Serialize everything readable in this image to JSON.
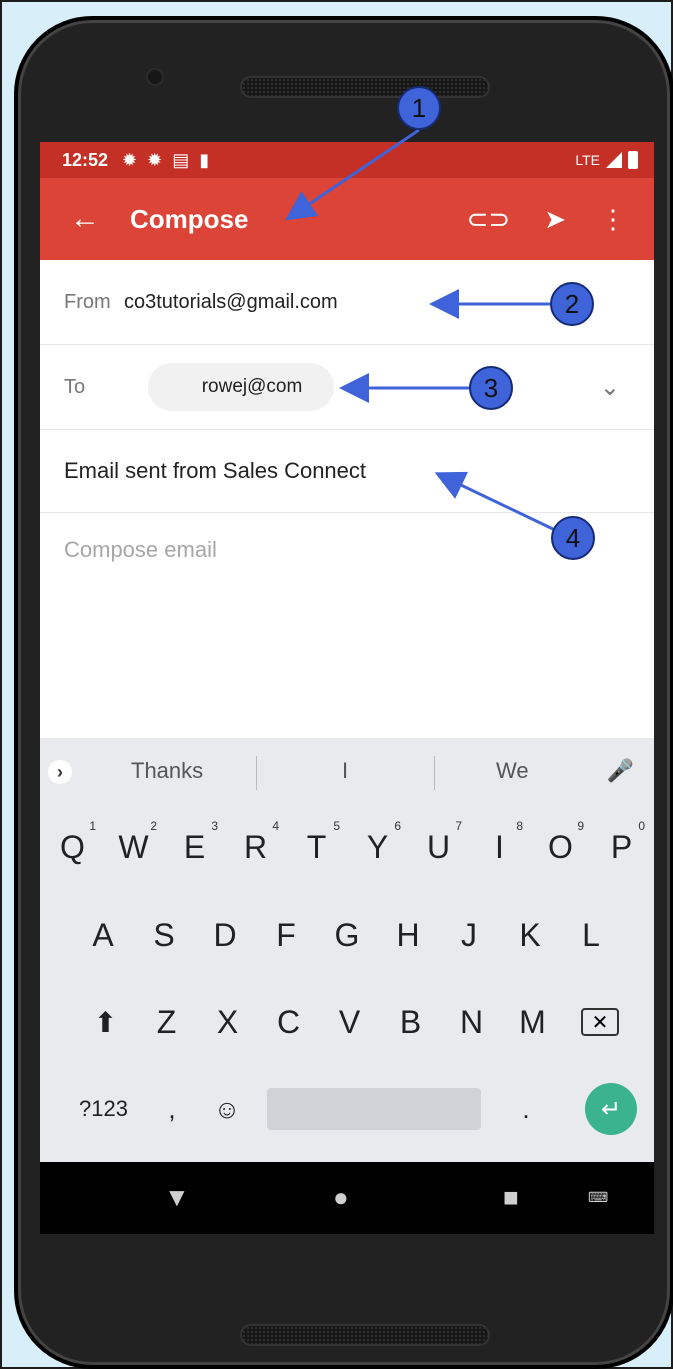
{
  "status_bar": {
    "time": "12:52",
    "network": "LTE"
  },
  "app_bar": {
    "title": "Compose"
  },
  "compose": {
    "from_label": "From",
    "from_value": "co3tutorials@gmail.com",
    "to_label": "To",
    "to_value": "rowej@com",
    "subject": "Email sent from Sales Connect",
    "body_placeholder": "Compose email"
  },
  "keyboard": {
    "suggestions": [
      "Thanks",
      "I",
      "We"
    ],
    "row1": [
      "Q",
      "W",
      "E",
      "R",
      "T",
      "Y",
      "U",
      "I",
      "O",
      "P"
    ],
    "row1_numbers": [
      "1",
      "2",
      "3",
      "4",
      "5",
      "6",
      "7",
      "8",
      "9",
      "0"
    ],
    "row2": [
      "A",
      "S",
      "D",
      "F",
      "G",
      "H",
      "J",
      "K",
      "L"
    ],
    "row3": [
      "Z",
      "X",
      "C",
      "V",
      "B",
      "N",
      "M"
    ],
    "symbols_key": "?123",
    "comma": ",",
    "period": "."
  },
  "callouts": [
    "1",
    "2",
    "3",
    "4"
  ],
  "colors": {
    "status_bar": "#c53026",
    "app_bar": "#db4437",
    "enter_key": "#3cb38f",
    "callout": "#3f63d9"
  },
  "icons": [
    "settings-icon",
    "attach-icon",
    "send-icon",
    "more-vert-icon",
    "back-arrow-icon",
    "chevron-down-icon",
    "mic-icon",
    "shift-icon",
    "backspace-icon",
    "emoji-icon",
    "enter-icon"
  ]
}
